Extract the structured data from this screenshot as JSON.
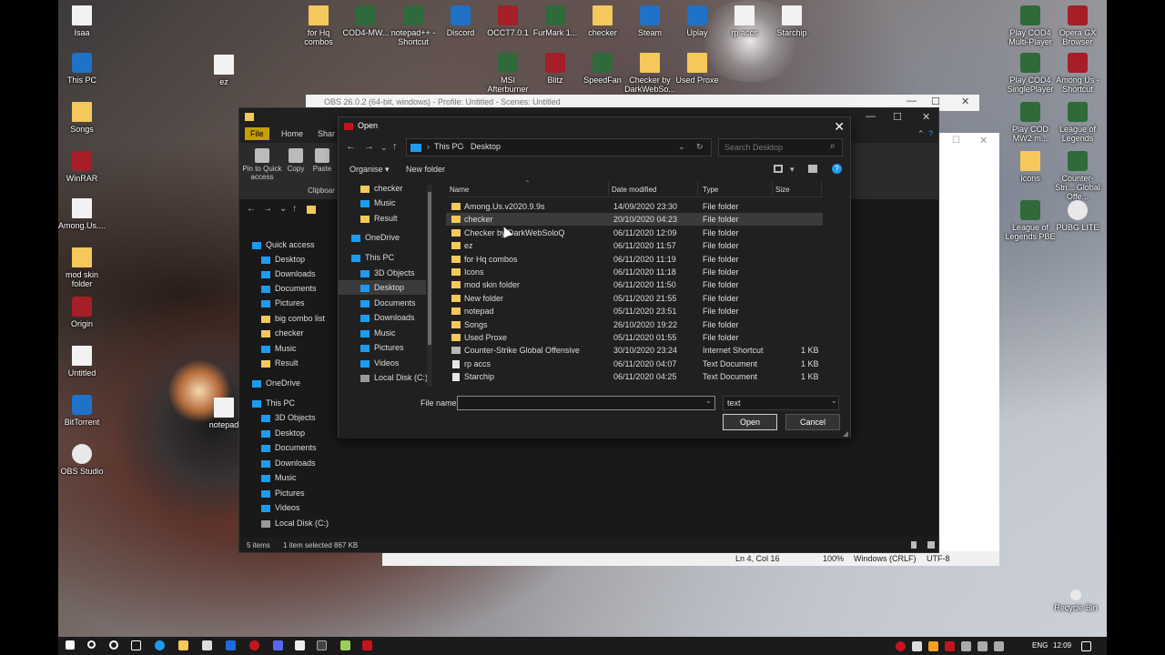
{
  "desktop": {
    "icons_left": [
      {
        "label": "Isaa",
        "kind": "file"
      },
      {
        "label": "This PC",
        "kind": "blue"
      },
      {
        "label": "Songs",
        "kind": "folder"
      },
      {
        "label": "WinRAR",
        "kind": "red"
      },
      {
        "label": "Among.Us....",
        "kind": "file"
      },
      {
        "label": "mod skin folder",
        "kind": "folder"
      },
      {
        "label": "Origin",
        "kind": "red"
      },
      {
        "label": "Untitled",
        "kind": "file"
      },
      {
        "label": "BitTorrent",
        "kind": "blue"
      },
      {
        "label": "OBS Studio",
        "kind": "white"
      }
    ],
    "icon_ez": "ez",
    "icons_top": [
      {
        "label": "for Hq combos",
        "kind": "folder"
      },
      {
        "label": "COD4-MW...",
        "kind": "app"
      },
      {
        "label": "notepad++ - Shortcut",
        "kind": "app"
      },
      {
        "label": "Discord",
        "kind": "blue"
      },
      {
        "label": "OCCT7.0.1",
        "kind": "red"
      },
      {
        "label": "FurMark 1...",
        "kind": "app"
      },
      {
        "label": "checker",
        "kind": "folder"
      },
      {
        "label": "Steam",
        "kind": "blue"
      },
      {
        "label": "Uplay",
        "kind": "blue"
      },
      {
        "label": "rp accs",
        "kind": "file"
      },
      {
        "label": "Starchip",
        "kind": "file"
      }
    ],
    "icons_top_row2": [
      {
        "label": "MSI Afterburner",
        "kind": "app"
      },
      {
        "label": "Blitz",
        "kind": "red"
      },
      {
        "label": "SpeedFan",
        "kind": "app"
      },
      {
        "label": "Checker by DarkWebSo...",
        "kind": "folder"
      },
      {
        "label": "Used Proxe",
        "kind": "folder"
      }
    ],
    "icons_right": [
      {
        "label": "Play COD4 Multi-Player",
        "kind": "app"
      },
      {
        "label": "Opera GX Browser",
        "kind": "red"
      },
      {
        "label": "Play COD4 SinglePlayer",
        "kind": "app"
      },
      {
        "label": "Among Us - Shortcut",
        "kind": "red"
      },
      {
        "label": "Play COD MW2 m...",
        "kind": "app"
      },
      {
        "label": "League of Legends",
        "kind": "app"
      },
      {
        "label": "Icons",
        "kind": "folder"
      },
      {
        "label": "Counter-Stri... Global Offe...",
        "kind": "app"
      },
      {
        "label": "League of Legends PBE",
        "kind": "app"
      },
      {
        "label": "PUBG LITE",
        "kind": "white"
      }
    ],
    "icon_notepad": "notepad",
    "icon_recycle": "Recycle Bin"
  },
  "obs": {
    "title": "OBS 26.0.2 (64-bit, windows) - Profile: Untitled - Scenes: Untitled"
  },
  "notepad": {
    "status_position": "Ln 4, Col 16",
    "zoom": "100%",
    "line_ending": "Windows (CRLF)",
    "encoding": "UTF-8"
  },
  "explorer": {
    "tabs": {
      "file": "File",
      "home": "Home",
      "share": "Shar"
    },
    "ribbon": {
      "pin": "Pin to Quick access",
      "copy": "Copy",
      "paste": "Paste",
      "clipboard": "Clipboar"
    },
    "nav": [
      {
        "label": "Quick access",
        "icon": "star"
      },
      {
        "label": "Desktop",
        "icon": "blue"
      },
      {
        "label": "Downloads",
        "icon": "blue"
      },
      {
        "label": "Documents",
        "icon": "blue"
      },
      {
        "label": "Pictures",
        "icon": "blue"
      },
      {
        "label": "big combo list",
        "icon": "folder"
      },
      {
        "label": "checker",
        "icon": "folder"
      },
      {
        "label": "Music",
        "icon": "blue"
      },
      {
        "label": "Result",
        "icon": "folder"
      },
      {
        "label": "OneDrive",
        "icon": "blue"
      },
      {
        "label": "This PC",
        "icon": "blue"
      },
      {
        "label": "3D Objects",
        "icon": "blue"
      },
      {
        "label": "Desktop",
        "icon": "blue"
      },
      {
        "label": "Documents",
        "icon": "blue"
      },
      {
        "label": "Downloads",
        "icon": "blue"
      },
      {
        "label": "Music",
        "icon": "blue"
      },
      {
        "label": "Pictures",
        "icon": "blue"
      },
      {
        "label": "Videos",
        "icon": "blue"
      },
      {
        "label": "Local Disk (C:)",
        "icon": "disk"
      }
    ],
    "status": {
      "items": "5 items",
      "selected": "1 item selected  867 KB"
    }
  },
  "dialog": {
    "title": "Open",
    "breadcrumb": {
      "root": "This PC",
      "sep": "›",
      "current": "Desktop"
    },
    "search_placeholder": "Search Desktop",
    "toolbar": {
      "organise": "Organise ▾",
      "new_folder": "New folder"
    },
    "nav": [
      {
        "label": "checker",
        "icon": "folder"
      },
      {
        "label": "Music",
        "icon": "blue"
      },
      {
        "label": "Result",
        "icon": "folder"
      },
      {
        "label": "OneDrive",
        "icon": "blue"
      },
      {
        "label": "This PC",
        "icon": "blue"
      },
      {
        "label": "3D Objects",
        "icon": "blue"
      },
      {
        "label": "Desktop",
        "icon": "blue"
      },
      {
        "label": "Documents",
        "icon": "blue"
      },
      {
        "label": "Downloads",
        "icon": "blue"
      },
      {
        "label": "Music",
        "icon": "blue"
      },
      {
        "label": "Pictures",
        "icon": "blue"
      },
      {
        "label": "Videos",
        "icon": "blue"
      },
      {
        "label": "Local Disk (C:)",
        "icon": "disk"
      }
    ],
    "columns": {
      "name": "Name",
      "date": "Date modified",
      "type": "Type",
      "size": "Size"
    },
    "files": [
      {
        "name": "Among.Us.v2020.9.9s",
        "date": "14/09/2020 23:30",
        "type": "File folder",
        "size": "",
        "kind": "folder"
      },
      {
        "name": "checker",
        "date": "20/10/2020 04:23",
        "type": "File folder",
        "size": "",
        "kind": "folder"
      },
      {
        "name": "Checker by DarkWebSoloQ",
        "date": "06/11/2020 12:09",
        "type": "File folder",
        "size": "",
        "kind": "folder"
      },
      {
        "name": "ez",
        "date": "06/11/2020 11:57",
        "type": "File folder",
        "size": "",
        "kind": "folder"
      },
      {
        "name": "for Hq combos",
        "date": "06/11/2020 11:19",
        "type": "File folder",
        "size": "",
        "kind": "folder"
      },
      {
        "name": "Icons",
        "date": "06/11/2020 11:18",
        "type": "File folder",
        "size": "",
        "kind": "folder"
      },
      {
        "name": "mod skin folder",
        "date": "06/11/2020 11:50",
        "type": "File folder",
        "size": "",
        "kind": "folder"
      },
      {
        "name": "New folder",
        "date": "05/11/2020 21:55",
        "type": "File folder",
        "size": "",
        "kind": "folder"
      },
      {
        "name": "notepad",
        "date": "05/11/2020 23:51",
        "type": "File folder",
        "size": "",
        "kind": "folder"
      },
      {
        "name": "Songs",
        "date": "26/10/2020 19:22",
        "type": "File folder",
        "size": "",
        "kind": "folder"
      },
      {
        "name": "Used Proxe",
        "date": "05/11/2020 01:55",
        "type": "File folder",
        "size": "",
        "kind": "folder"
      },
      {
        "name": "Counter-Strike Global Offensive",
        "date": "30/10/2020 23:24",
        "type": "Internet Shortcut",
        "size": "1 KB",
        "kind": "link"
      },
      {
        "name": "rp accs",
        "date": "06/11/2020 04:07",
        "type": "Text Document",
        "size": "1 KB",
        "kind": "doc"
      },
      {
        "name": "Starchip",
        "date": "06/11/2020 04:25",
        "type": "Text Document",
        "size": "1 KB",
        "kind": "doc"
      }
    ],
    "selected_index": 1,
    "file_name_label": "File name:",
    "file_name_value": "",
    "file_type": "text",
    "open_label": "Open",
    "cancel_label": "Cancel"
  },
  "taskbar": {
    "lang": "ENG",
    "time": "12:09"
  },
  "colors": {
    "accent": "#1d9bf0",
    "folder": "#f4c85a",
    "selection": "#3b3b3b",
    "dialog_bg": "#202020"
  }
}
